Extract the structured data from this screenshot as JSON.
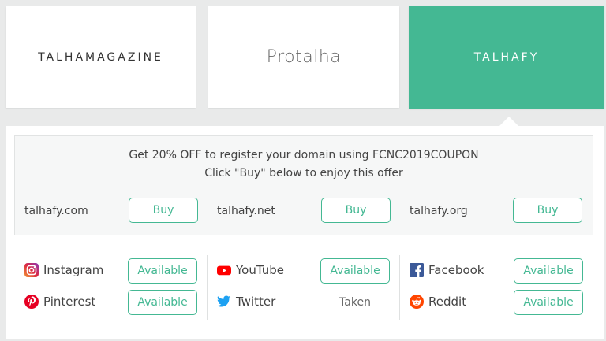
{
  "cards": [
    {
      "label": "TALHAMAGAZINE"
    },
    {
      "label": "Protalha"
    },
    {
      "label": "TALHAFY"
    }
  ],
  "offer": {
    "line1": "Get 20% OFF to register your domain using FCNC2019COUPON",
    "line2": "Click \"Buy\" below to enjoy this offer"
  },
  "domains": [
    {
      "name": "talhafy.com",
      "button": "Buy"
    },
    {
      "name": "talhafy.net",
      "button": "Buy"
    },
    {
      "name": "talhafy.org",
      "button": "Buy"
    }
  ],
  "socials": [
    {
      "name": "Instagram",
      "status": "Available",
      "icon": "instagram-icon"
    },
    {
      "name": "Pinterest",
      "status": "Available",
      "icon": "pinterest-icon"
    },
    {
      "name": "YouTube",
      "status": "Available",
      "icon": "youtube-icon"
    },
    {
      "name": "Twitter",
      "status": "Taken",
      "icon": "twitter-icon"
    },
    {
      "name": "Facebook",
      "status": "Available",
      "icon": "facebook-icon"
    },
    {
      "name": "Reddit",
      "status": "Available",
      "icon": "reddit-icon"
    }
  ],
  "colors": {
    "accent": "#44b893",
    "background": "#e9eaea"
  }
}
